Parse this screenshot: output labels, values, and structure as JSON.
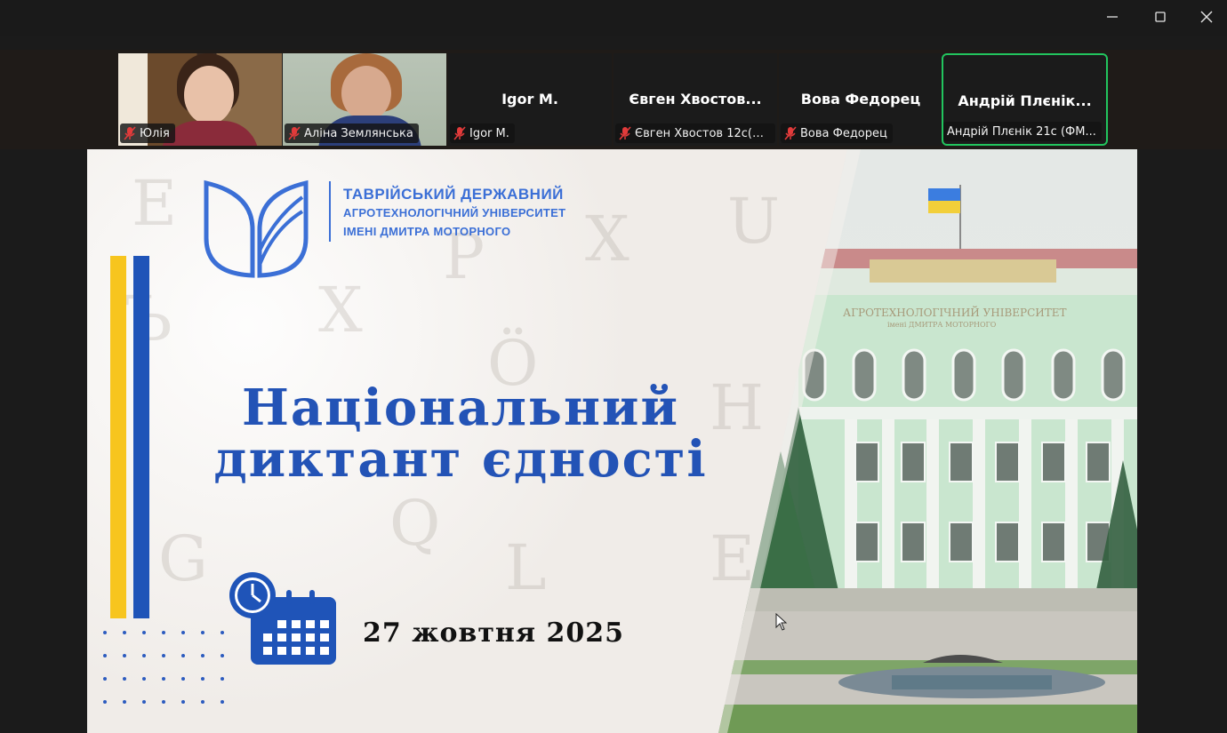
{
  "window": {
    "controls": {
      "minimize_icon": "minimize-icon",
      "maximize_icon": "maximize-icon",
      "close_icon": "close-icon"
    }
  },
  "participants": [
    {
      "name": "Юлія",
      "tag": "Юлія",
      "video": true,
      "muted": true
    },
    {
      "name": "Аліна Землянська",
      "tag": "Аліна Землянська",
      "video": true,
      "muted": true
    },
    {
      "name": "Igor M.",
      "tag": "Igor M.",
      "video": false,
      "muted": true
    },
    {
      "name": "Євген Хвостов...",
      "tag": "Євген Хвостов 12с(Ф...",
      "video": false,
      "muted": true
    },
    {
      "name": "Вова Федорец",
      "tag": "Вова Федорец",
      "video": false,
      "muted": true
    },
    {
      "name": "Андрій Плєнік...",
      "tag": "Андрій Плєнік 21с (ФМ...",
      "video": false,
      "muted": false,
      "active_speaker": true
    }
  ],
  "slide": {
    "university": {
      "line1": "ТАВРІЙСЬКИЙ ДЕРЖАВНИЙ",
      "line2": "АГРОТЕХНОЛОГІЧНИЙ УНІВЕРСИТЕТ",
      "line3": "ІМЕНІ ДМИТРА МОТОРНОГО"
    },
    "title_line1": "Національний",
    "title_line2": "диктант єдності",
    "date": "27 жовтня 2025",
    "building_sign_line1": "АГРОТЕХНОЛОГІЧНИЙ УНІВЕРСИТЕТ",
    "building_sign_line2": "імені ДМИТРА МОТОРНОГО"
  },
  "colors": {
    "accent_blue": "#2353b6",
    "logo_blue": "#3b6fd6",
    "stripe_yellow": "#f7c51e",
    "stripe_blue": "#1f54b8",
    "active_speaker_border": "#22c55e",
    "muted_red": "#e23b3b"
  }
}
